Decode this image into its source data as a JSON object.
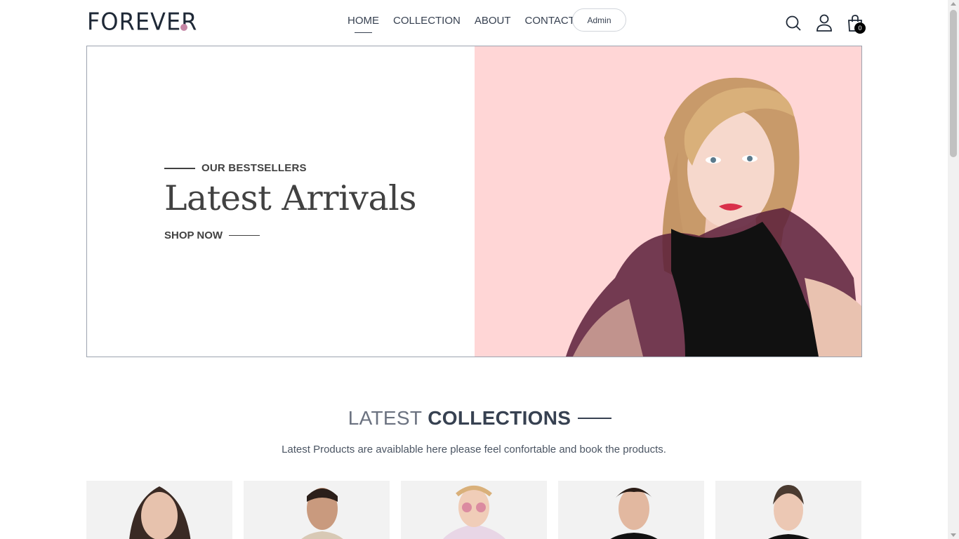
{
  "header": {
    "logo": "FOREVER",
    "nav": [
      {
        "label": "HOME",
        "active": true
      },
      {
        "label": "COLLECTION",
        "active": false
      },
      {
        "label": "ABOUT",
        "active": false
      },
      {
        "label": "CONTACT",
        "active": false
      }
    ],
    "admin_label": "Admin",
    "cart_count": "0",
    "icons": [
      "search-icon",
      "profile-icon",
      "cart-icon"
    ]
  },
  "hero": {
    "eyebrow": "OUR BESTSELLERS",
    "title": "Latest Arrivals",
    "cta": "SHOP NOW",
    "image_background": "#ffd6d6"
  },
  "collections": {
    "title_light": "LATEST",
    "title_bold": "COLLECTIONS",
    "subtitle": "Latest Products are avaiblable here please feel confortable and book the products."
  },
  "products": [
    {
      "image": "woman-portrait"
    },
    {
      "image": "man-beige-jacket"
    },
    {
      "image": "girl-sunglasses"
    },
    {
      "image": "man-curly-hair-black-tee"
    },
    {
      "image": "woman-black-tee"
    }
  ],
  "colors": {
    "accent_dot": "#c586a5",
    "text_dark": "#374151",
    "hero_pink": "#ffd6d6"
  }
}
